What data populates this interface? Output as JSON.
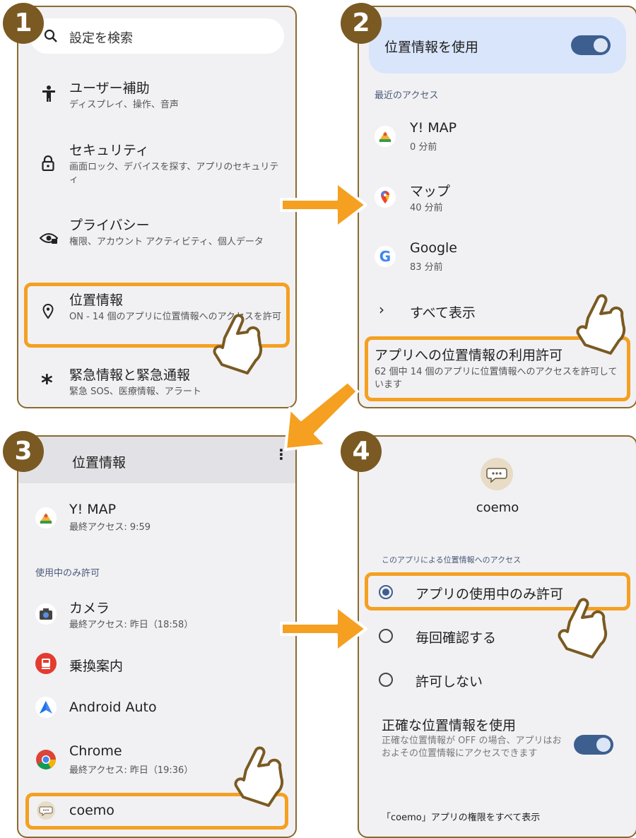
{
  "badges": [
    "1",
    "2",
    "3",
    "4"
  ],
  "panel1": {
    "search_placeholder": "設定を検索",
    "items": [
      {
        "title": "ユーザー補助",
        "sub": "ディスプレイ、操作、音声",
        "icon": "accessibility-icon"
      },
      {
        "title": "セキュリティ",
        "sub": "画面ロック、デバイスを探す、アプリのセキュリティ",
        "icon": "lock-icon"
      },
      {
        "title": "プライバシー",
        "sub": "権限、アカウント アクティビティ、個人データ",
        "icon": "privacy-eye-icon"
      },
      {
        "title": "位置情報",
        "sub": "ON - 14 個のアプリに位置情報へのアクセスを許可",
        "icon": "location-pin-icon"
      },
      {
        "title": "緊急情報と緊急通報",
        "sub": "緊急 SOS、医療情報、アラート",
        "icon": "asterisk-icon"
      }
    ]
  },
  "panel2": {
    "use_location_label": "位置情報を使用",
    "recent_access_header": "最近のアクセス",
    "recent": [
      {
        "title": "Y! MAP",
        "sub": "0 分前",
        "icon": "ymap-icon"
      },
      {
        "title": "マップ",
        "sub": "40 分前",
        "icon": "google-maps-icon"
      },
      {
        "title": "Google",
        "sub": "83 分前",
        "icon": "google-g-icon"
      }
    ],
    "show_all": "すべて表示",
    "permission_title": "アプリへの位置情報の利用許可",
    "permission_sub": "62 個中 14 個のアプリに位置情報へのアクセスを許可しています"
  },
  "panel3": {
    "header_title": "位置情報",
    "top_app": {
      "title": "Y! MAP",
      "sub": "最終アクセス: 9:59"
    },
    "section_header": "使用中のみ許可",
    "apps": [
      {
        "title": "カメラ",
        "sub": "最終アクセス: 昨日（18:58）",
        "icon": "camera-icon"
      },
      {
        "title": "乗換案内",
        "sub": "",
        "icon": "train-icon"
      },
      {
        "title": "Android Auto",
        "sub": "",
        "icon": "android-auto-icon"
      },
      {
        "title": "Chrome",
        "sub": "最終アクセス: 昨日（19:36）",
        "icon": "chrome-icon"
      },
      {
        "title": "coemo",
        "sub": "",
        "icon": "coemo-icon"
      }
    ]
  },
  "panel4": {
    "app_name": "coemo",
    "section_header": "このアプリによる位置情報へのアクセス",
    "options": [
      "アプリの使用中のみ許可",
      "毎回確認する",
      "許可しない"
    ],
    "selected_index": 0,
    "precise_title": "正確な位置情報を使用",
    "precise_sub": "正確な位置情報が OFF の場合、アプリはおおよその位置情報にアクセスできます",
    "footer_link": "「coemo」アプリの権限をすべて表示"
  },
  "colors": {
    "accent": "#f5a021",
    "border": "#8a6a2e",
    "badge": "#7a5a22",
    "toggle": "#3d5f90",
    "panel_bg": "#f1f1f4"
  }
}
